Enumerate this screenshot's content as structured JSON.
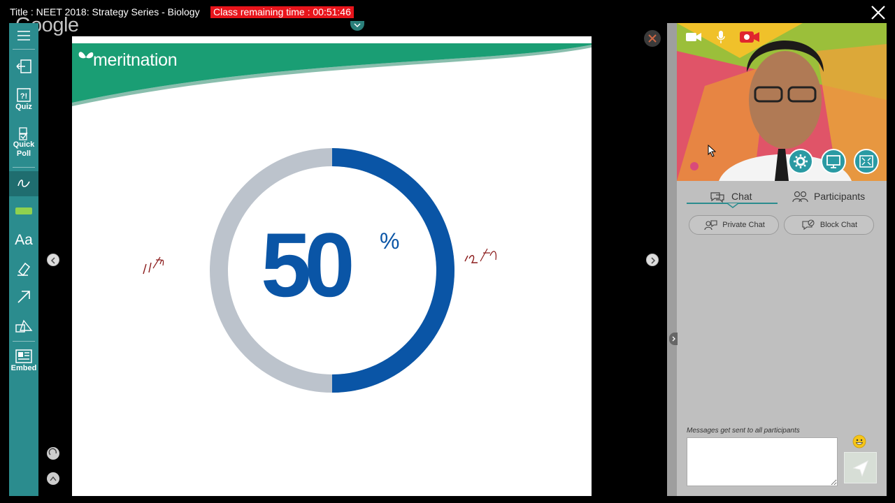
{
  "header": {
    "title": "Title : NEET 2018: Strategy Series - Biology",
    "timer": "Class remaining time : 00:51:46",
    "watermark": "Google"
  },
  "toolbar": {
    "items": [
      {
        "name": "menu",
        "label": ""
      },
      {
        "name": "exit",
        "label": ""
      },
      {
        "name": "quiz",
        "label": "Quiz"
      },
      {
        "name": "quick-poll",
        "label_line1": "Quick",
        "label_line2": "Poll"
      },
      {
        "name": "pen",
        "label": ""
      },
      {
        "name": "highlighter",
        "label": ""
      },
      {
        "name": "text",
        "label": "Aa"
      },
      {
        "name": "eraser",
        "label": ""
      },
      {
        "name": "arrow",
        "label": ""
      },
      {
        "name": "shapes",
        "label": ""
      },
      {
        "name": "embed",
        "label": "Embed"
      }
    ],
    "accent": "#2b8c8e"
  },
  "slide": {
    "brand": "meritnation",
    "percent_value": "50",
    "percent_sign": "%",
    "progress_fraction": 0.5,
    "annotation_left": "11th",
    "annotation_right": "12th",
    "ring_color": "#0a55a6",
    "ring_track_color": "#bcc3cc",
    "header_color": "#1a9e74"
  },
  "panel": {
    "tabs": {
      "chat": "Chat",
      "participants": "Participants"
    },
    "buttons": {
      "private_chat": "Private Chat",
      "block_chat": "Block Chat"
    },
    "message_note": "Messages get sent to all participants",
    "message_input_value": ""
  }
}
